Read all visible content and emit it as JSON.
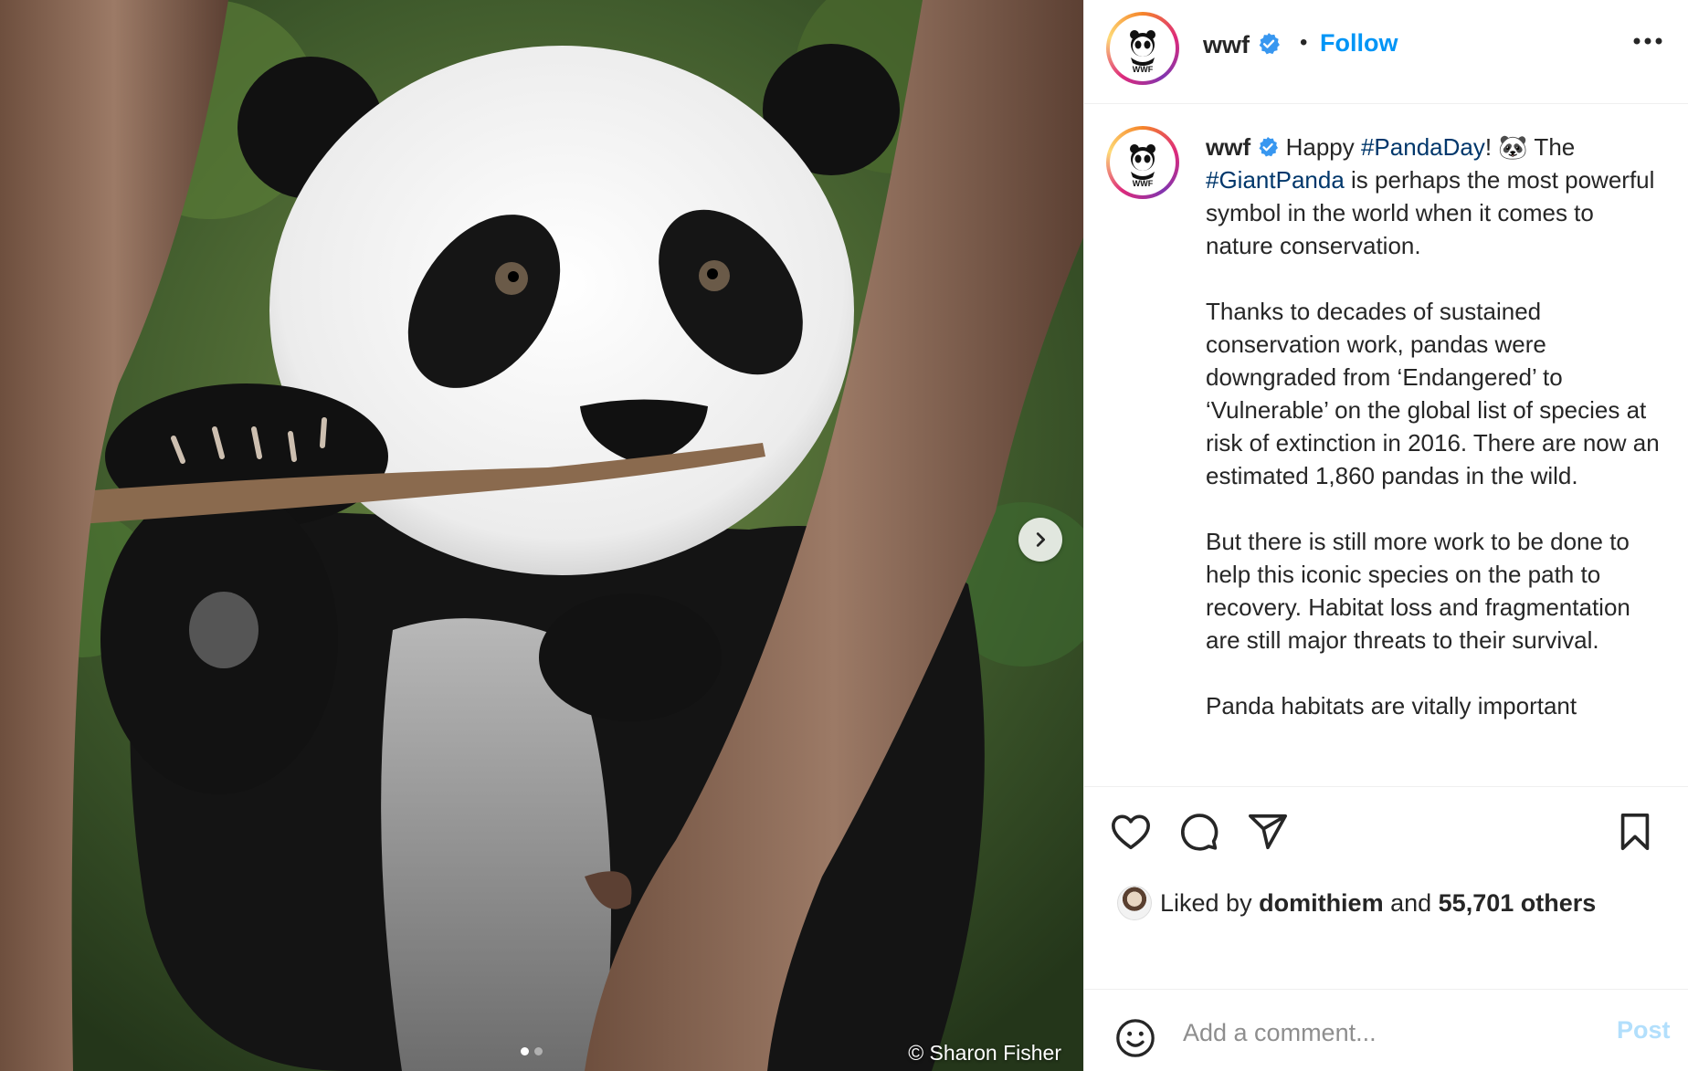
{
  "media": {
    "credit": "© Sharon Fisher",
    "slide_count": 2,
    "active_slide": 1,
    "next_icon": "chevron-right-icon"
  },
  "header": {
    "username": "wwf",
    "separator": "•",
    "follow_label": "Follow",
    "avatar_text": "WWF",
    "more_icon": "more-horizontal-icon"
  },
  "caption": {
    "username": "wwf",
    "intro_1": "Happy ",
    "tag_1": "#PandaDay",
    "intro_2": "! 🐼 The ",
    "tag_2": "#GiantPanda",
    "intro_3": " is perhaps the most powerful symbol in the world when it comes to nature conservation.",
    "paragraph_2": "Thanks to decades of sustained conservation work, pandas were downgraded from ‘Endangered’ to ‘Vulnerable’ on the global list of species at risk of extinction in 2016. There are now an estimated 1,860 pandas in the wild.",
    "paragraph_3": "But there is still more work to be done to help this iconic species on the path to recovery. Habitat loss and fragmentation are still major threats to their survival.",
    "paragraph_4": "Panda habitats are vitally important"
  },
  "actions": {
    "like_icon": "heart-icon",
    "comment_icon": "comment-icon",
    "share_icon": "share-icon",
    "save_icon": "bookmark-icon"
  },
  "likes": {
    "prefix": "Liked by ",
    "user": "domithiem",
    "middle": " and ",
    "count": "55,701 others"
  },
  "comment": {
    "placeholder": "Add a comment...",
    "post_label": "Post",
    "emoji_icon": "emoji-icon"
  },
  "colors": {
    "accent": "#0095f6",
    "hashtag": "#00376b",
    "verified": "#3897f0",
    "post_disabled": "#b2dffc"
  }
}
